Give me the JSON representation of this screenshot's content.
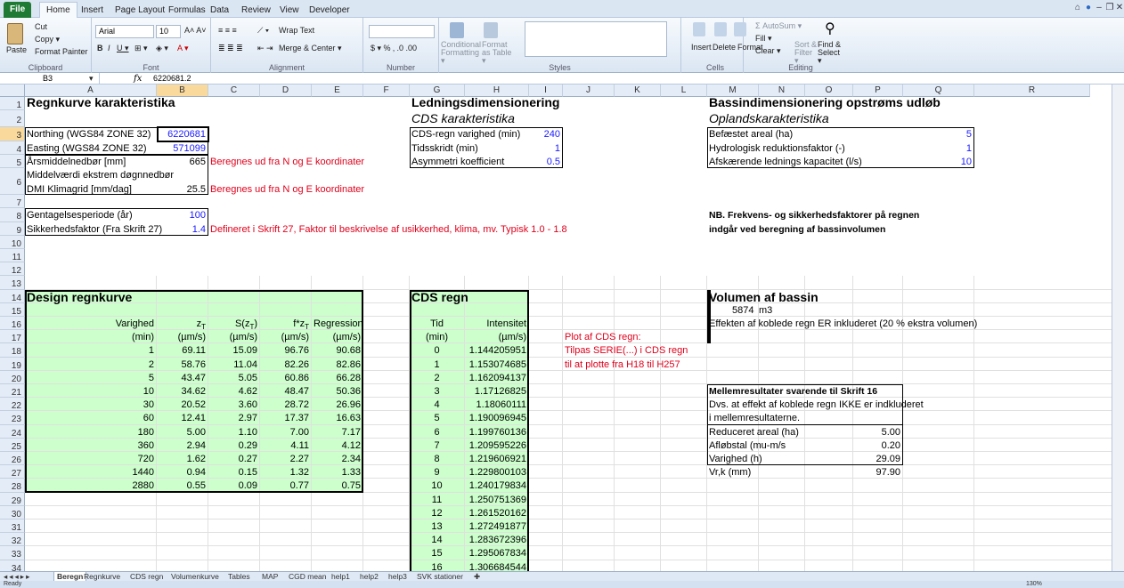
{
  "ribbon_tabs": [
    "File",
    "Home",
    "Insert",
    "Page Layout",
    "Formulas",
    "Data",
    "Review",
    "View",
    "Developer"
  ],
  "ribbon": {
    "clipboard": {
      "paste": "Paste",
      "cut": "Cut",
      "copy": "Copy ▾",
      "format_painter": "Format Painter",
      "label": "Clipboard"
    },
    "font": {
      "name": "Arial",
      "size": "10",
      "label": "Font"
    },
    "alignment": {
      "wrap": "Wrap Text",
      "merge": "Merge & Center ▾",
      "label": "Alignment"
    },
    "number": {
      "label": "Number"
    },
    "styles": {
      "cond": "Conditional Formatting ▾",
      "format_table": "Format as Table ▾",
      "label": "Styles"
    },
    "cells": {
      "insert": "Insert",
      "delete": "Delete",
      "format": "Format",
      "label": "Cells"
    },
    "editing": {
      "autosum": "Σ AutoSum ▾",
      "fill": "Fill ▾",
      "clear": "Clear ▾",
      "sort": "Sort & Filter ▾",
      "find": "Find & Select ▾",
      "label": "Editing"
    }
  },
  "formula_bar": {
    "name_box": "B3",
    "fx": "fx",
    "value": "6220681.2"
  },
  "columns": [
    "A",
    "B",
    "C",
    "D",
    "E",
    "F",
    "G",
    "H",
    "I",
    "J",
    "K",
    "L",
    "M",
    "N",
    "O",
    "P",
    "Q",
    "R"
  ],
  "rows": [
    "1",
    "2",
    "3",
    "4",
    "5",
    "6",
    "7",
    "8",
    "9",
    "10",
    "11",
    "12",
    "13",
    "14",
    "15",
    "16",
    "17",
    "18",
    "19",
    "20",
    "21",
    "22",
    "23",
    "24",
    "25",
    "26",
    "27",
    "28",
    "29",
    "30",
    "31",
    "32",
    "33",
    "34"
  ],
  "regnkurve": {
    "title": "Regnkurve karakteristika",
    "northing_label": "Northing (WGS84 ZONE 32)",
    "northing": "6220681",
    "easting_label": "Easting (WGS84 ZONE 32)",
    "easting": "571099",
    "aarsmiddel_label": "Årsmiddelnedbør [mm]",
    "aarsmiddel": "665",
    "aarsmiddel_note": "Beregnes ud fra N og E koordinater",
    "middel_label1": "Middelværdi ekstrem døgnnedbør",
    "middel_label2": "DMI Klimagrid [mm/dag]",
    "middel": "25.5",
    "middel_note": "Beregnes ud fra N og E koordinater",
    "gentagelse_label": "Gentagelsesperiode (år)",
    "gentagelse": "100",
    "sikkerhed_label": "Sikkerhedsfaktor (Fra Skrift 27)",
    "sikkerhed": "1.4",
    "sikkerhed_note": "Defineret i Skrift 27, Faktor til beskrivelse af usikkerhed, klima, mv. Typisk 1.0 - 1.8"
  },
  "ledning": {
    "title": "Ledningsdimensionering",
    "subtitle": "CDS karakteristika",
    "rows": [
      {
        "label": "CDS-regn varighed (min)",
        "value": "240"
      },
      {
        "label": "Tidsskridt (min)",
        "value": "1"
      },
      {
        "label": "Asymmetri koefficient",
        "value": "0.5"
      }
    ]
  },
  "bassin": {
    "title": "Bassindimensionering opstrøms udløb",
    "subtitle": "Oplandskarakteristika",
    "rows": [
      {
        "label": "Befæstet areal (ha)",
        "value": "5"
      },
      {
        "label": "Hydrologisk reduktionsfaktor (-)",
        "value": "1"
      },
      {
        "label": "Afskærende lednings kapacitet (l/s)",
        "value": "10"
      }
    ],
    "nb1": "NB. Frekvens- og sikkerhedsfaktorer på regnen",
    "nb2": "indgår ved beregning af bassinvolumen"
  },
  "design": {
    "title": "Design regnkurve",
    "headers": [
      "Varighed",
      "zT",
      "S(zT)",
      "f*zT",
      "Regression"
    ],
    "units": [
      "(min)",
      "(µm/s)",
      "(µm/s)",
      "(µm/s)",
      "(µm/s)"
    ],
    "rows": [
      [
        "1",
        "69.11",
        "15.09",
        "96.76",
        "90.68"
      ],
      [
        "2",
        "58.76",
        "11.04",
        "82.26",
        "82.86"
      ],
      [
        "5",
        "43.47",
        "5.05",
        "60.86",
        "66.28"
      ],
      [
        "10",
        "34.62",
        "4.62",
        "48.47",
        "50.36"
      ],
      [
        "30",
        "20.52",
        "3.60",
        "28.72",
        "26.96"
      ],
      [
        "60",
        "12.41",
        "2.97",
        "17.37",
        "16.63"
      ],
      [
        "180",
        "5.00",
        "1.10",
        "7.00",
        "7.17"
      ],
      [
        "360",
        "2.94",
        "0.29",
        "4.11",
        "4.12"
      ],
      [
        "720",
        "1.62",
        "0.27",
        "2.27",
        "2.34"
      ],
      [
        "1440",
        "0.94",
        "0.15",
        "1.32",
        "1.33"
      ],
      [
        "2880",
        "0.55",
        "0.09",
        "0.77",
        "0.75"
      ]
    ]
  },
  "cds": {
    "title": "CDS regn",
    "headers": [
      "Tid",
      "Intensitet"
    ],
    "units": [
      "(min)",
      "(µm/s)"
    ],
    "rows": [
      [
        "0",
        "1.144205951"
      ],
      [
        "1",
        "1.153074685"
      ],
      [
        "2",
        "1.162094137"
      ],
      [
        "3",
        "1.17126825"
      ],
      [
        "4",
        "1.18060111"
      ],
      [
        "5",
        "1.190096945"
      ],
      [
        "6",
        "1.199760136"
      ],
      [
        "7",
        "1.209595226"
      ],
      [
        "8",
        "1.219606921"
      ],
      [
        "9",
        "1.229800103"
      ],
      [
        "10",
        "1.240179834"
      ],
      [
        "11",
        "1.250751369"
      ],
      [
        "12",
        "1.261520162"
      ],
      [
        "13",
        "1.272491877"
      ],
      [
        "14",
        "1.283672396"
      ],
      [
        "15",
        "1.295067834"
      ],
      [
        "16",
        "1.306684544"
      ]
    ],
    "note1": "Plot af CDS regn:",
    "note2": "Tilpas SERIE(...) i CDS regn",
    "note3": "til at plotte fra H18 til H257"
  },
  "volumen": {
    "title": "Volumen af bassin",
    "value": "5874",
    "unit": "m3",
    "note": "Effekten af koblede regn ER inkluderet (20 % ekstra volumen)"
  },
  "mellem": {
    "title": "Mellemresultater svarende til Skrift 16",
    "line1": "Dvs. at effekt af koblede regn IKKE er indkluderet",
    "line2": "i mellemresultaterne.",
    "rows": [
      {
        "label": "Reduceret areal (ha)",
        "value": "5.00"
      },
      {
        "label": "Afløbstal (mu-m/s",
        "value": "0.20"
      },
      {
        "label": "Varighed (h)",
        "value": "29.09"
      },
      {
        "label": "Vr,k (mm)",
        "value": "97.90"
      }
    ]
  },
  "sheets": [
    "Beregn",
    "Regnkurve",
    "CDS regn",
    "Volumenkurve",
    "Tables",
    "MAP",
    "CGD mean",
    "help1",
    "help2",
    "help3",
    "SVK stationer"
  ],
  "status": {
    "ready": "Ready",
    "zoom": "130%"
  },
  "colors": {
    "yellow": "#ffff99",
    "green": "#ccffcc",
    "selected": "#f9d99c"
  }
}
